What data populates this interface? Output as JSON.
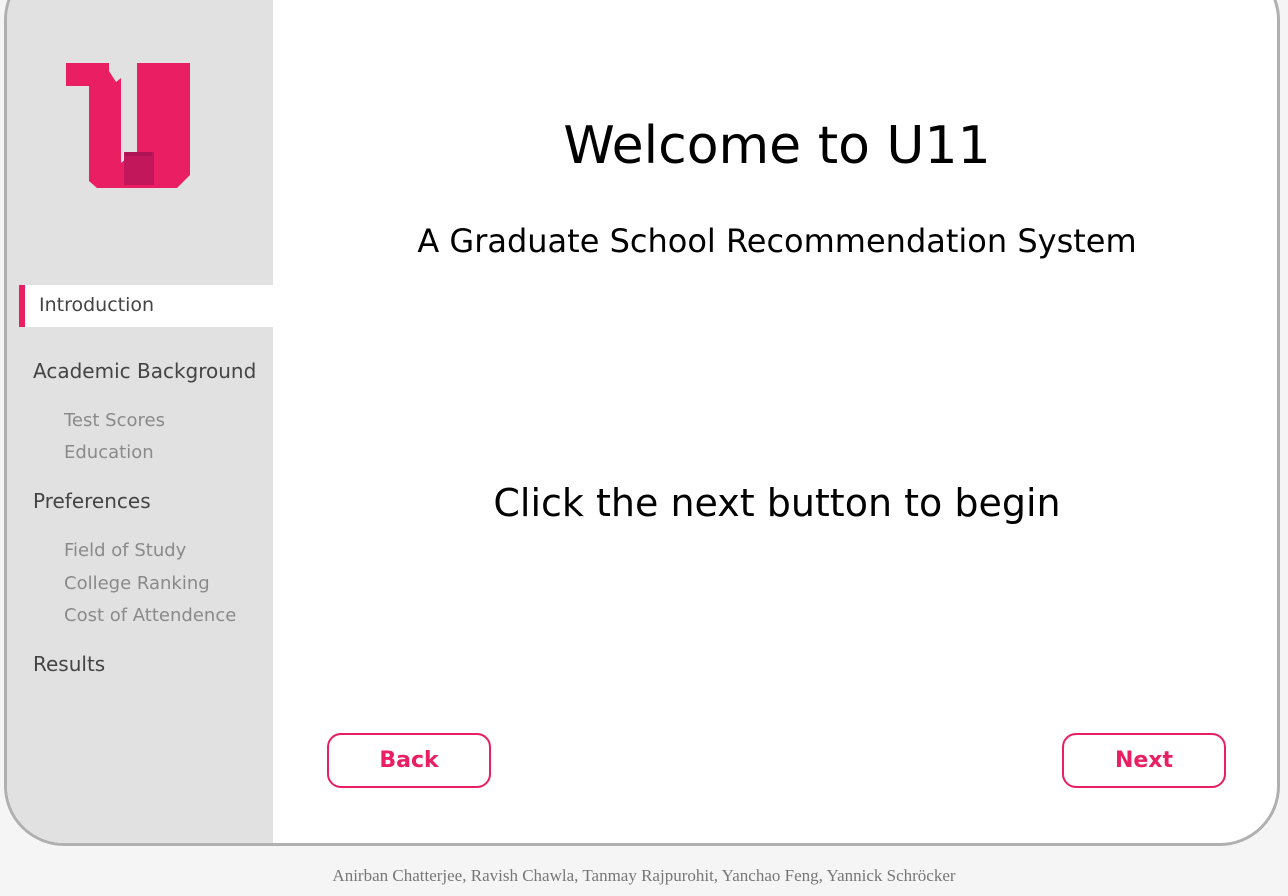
{
  "sidebar": {
    "logo_icon": "u11-logo",
    "active_item": "Introduction",
    "sections": [
      {
        "label": "Academic Background",
        "items": [
          "Test Scores",
          "Education"
        ]
      },
      {
        "label": "Preferences",
        "items": [
          "Field of Study",
          "College Ranking",
          "Cost of Attendence"
        ]
      },
      {
        "label": "Results",
        "items": []
      }
    ]
  },
  "main": {
    "title": "Welcome to U11",
    "subtitle": "A Graduate School Recommendation System",
    "prompt": "Click the next button to begin",
    "back_label": "Back",
    "next_label": "Next"
  },
  "footer": {
    "authors": "Anirban Chatterjee, Ravish Chawla, Tanmay Rajpurohit, Yanchao Feng, Yannick Schröcker"
  },
  "colors": {
    "accent": "#e91e63",
    "sidebar_bg": "#e1e1e1"
  }
}
